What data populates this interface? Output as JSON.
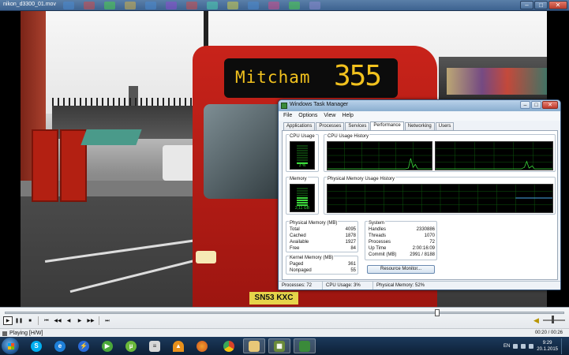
{
  "player": {
    "title": "nikon_d3300_01.mov",
    "status_text": "Playing [H/W]",
    "time": "00:20 / 00:26",
    "seek_position": 0.77,
    "volume_level": 0.5,
    "buttons": {
      "play": "▶",
      "pause": "❚❚",
      "stop": "■",
      "prev": "⏮",
      "rewind": "◀◀",
      "step_back": "◀",
      "step_fwd": "▶",
      "ffwd": "▶▶",
      "next": "⏭"
    }
  },
  "video": {
    "bus_destination": "Mitcham",
    "bus_number": "355",
    "bus_plate": "SN53 KXC"
  },
  "task_manager": {
    "title": "Windows Task Manager",
    "menu": [
      "File",
      "Options",
      "View",
      "Help"
    ],
    "tabs": [
      "Applications",
      "Processes",
      "Services",
      "Performance",
      "Networking",
      "Users"
    ],
    "active_tab": "Performance",
    "cpu_usage_label": "CPU Usage",
    "cpu_usage_value": "3 %",
    "cpu_usage_level": 0.03,
    "cpu_history_label": "CPU Usage History",
    "memory_label": "Memory",
    "memory_value": "2,11 GB",
    "memory_level": 0.52,
    "memory_history_label": "Physical Memory Usage History",
    "physical_memory": {
      "label": "Physical Memory (MB)",
      "rows": [
        {
          "name": "Total",
          "value": "4095"
        },
        {
          "name": "Cached",
          "value": "1878"
        },
        {
          "name": "Available",
          "value": "1927"
        },
        {
          "name": "Free",
          "value": "84"
        }
      ]
    },
    "kernel_memory": {
      "label": "Kernel Memory (MB)",
      "rows": [
        {
          "name": "Paged",
          "value": "361"
        },
        {
          "name": "Nonpaged",
          "value": "55"
        }
      ]
    },
    "system": {
      "label": "System",
      "rows": [
        {
          "name": "Handles",
          "value": "2330886"
        },
        {
          "name": "Threads",
          "value": "1070"
        },
        {
          "name": "Processes",
          "value": "72"
        },
        {
          "name": "Up Time",
          "value": "2:00:16:09"
        },
        {
          "name": "Commit (MB)",
          "value": "2991 / 8188"
        }
      ]
    },
    "resource_button": "Resource Monitor...",
    "status": {
      "processes": "Processes: 72",
      "cpu": "CPU Usage: 3%",
      "memory": "Physical Memory: 52%"
    }
  },
  "taskbar": {
    "tray_lang": "EN",
    "time": "9:29",
    "date": "20.1.2015"
  }
}
